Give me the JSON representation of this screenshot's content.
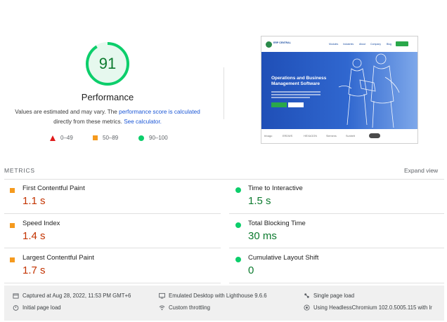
{
  "gauge": {
    "score": "91",
    "score_fraction": 0.91,
    "label": "Performance",
    "desc_prefix": "Values are estimated and may vary. The",
    "desc_link1": "performance score is calculated",
    "desc_middle": "directly from these metrics.",
    "desc_link2": "See calculator.",
    "color": "#0cce6b"
  },
  "legend": {
    "fail": "0–49",
    "average": "50–89",
    "pass": "90–100"
  },
  "thumbnail": {
    "logo_text": "ERP CENTRAL",
    "nav": [
      "Modules",
      "Industries",
      "About",
      "Company",
      "Blog"
    ],
    "headline": "Operations and Business Management Software",
    "logos": [
      "trivago",
      "ERDWS",
      "HEXAGON",
      "Siemens",
      "Sunbelt"
    ]
  },
  "metrics": {
    "title": "METRICS",
    "expand": "Expand view",
    "items": [
      {
        "label": "First Contentful Paint",
        "value": "1.1 s",
        "rating": "average"
      },
      {
        "label": "Time to Interactive",
        "value": "1.5 s",
        "rating": "pass"
      },
      {
        "label": "Speed Index",
        "value": "1.4 s",
        "rating": "average"
      },
      {
        "label": "Total Blocking Time",
        "value": "30 ms",
        "rating": "pass"
      },
      {
        "label": "Largest Contentful Paint",
        "value": "1.7 s",
        "rating": "average"
      },
      {
        "label": "Cumulative Layout Shift",
        "value": "0",
        "rating": "pass"
      }
    ]
  },
  "footer": {
    "captured": "Captured at Aug 28, 2022, 11:53 PM GMT+6",
    "emulated": "Emulated Desktop with Lighthouse 9.6.6",
    "single_load": "Single page load",
    "initial_load": "Initial page load",
    "throttling": "Custom throttling",
    "browser": "Using HeadlessChromium 102.0.5005.115 with lr"
  },
  "colors": {
    "pass": "#0cce6b",
    "average": "#f59a1e",
    "fail": "#e01b1b",
    "link": "#1a56d6"
  }
}
